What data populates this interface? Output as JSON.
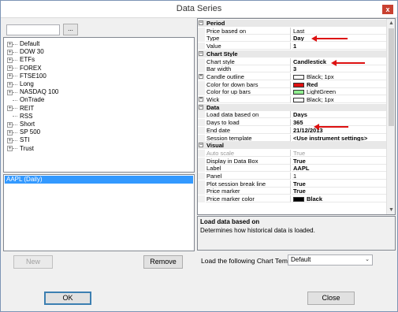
{
  "window": {
    "title": "Data Series",
    "close_glyph": "x"
  },
  "left": {
    "search": {
      "value": "",
      "browse_label": "..."
    },
    "tree": [
      {
        "label": "Default",
        "expand": "+"
      },
      {
        "label": "DOW 30",
        "expand": "+"
      },
      {
        "label": "ETFs",
        "expand": "+"
      },
      {
        "label": "FOREX",
        "expand": "+"
      },
      {
        "label": "FTSE100",
        "expand": "+"
      },
      {
        "label": "Long",
        "expand": "+"
      },
      {
        "label": "NASDAQ 100",
        "expand": "+"
      },
      {
        "label": "OnTrade",
        "expand": ""
      },
      {
        "label": "REIT",
        "expand": "+"
      },
      {
        "label": "RSS",
        "expand": ""
      },
      {
        "label": "Short",
        "expand": "+"
      },
      {
        "label": "SP 500",
        "expand": "+"
      },
      {
        "label": "STI",
        "expand": "+"
      },
      {
        "label": "Trust",
        "expand": "+"
      }
    ],
    "selected_series": "AAPL (Daily)",
    "new_label": "New",
    "remove_label": "Remove"
  },
  "grid": {
    "rows": [
      {
        "kind": "cat",
        "name": "Period",
        "toggle": "⊟"
      },
      {
        "kind": "prop",
        "name": "Price based on",
        "value": "Last"
      },
      {
        "kind": "prop",
        "name": "Type",
        "value": "Day",
        "bold": true
      },
      {
        "kind": "prop",
        "name": "Value",
        "value": "1",
        "bold": true
      },
      {
        "kind": "cat",
        "name": "Chart Style",
        "toggle": "⊟"
      },
      {
        "kind": "prop",
        "name": "Chart style",
        "value": "Candlestick",
        "bold": true
      },
      {
        "kind": "prop",
        "name": "Bar width",
        "value": "3",
        "bold": true
      },
      {
        "kind": "prop",
        "name": "Candle outline",
        "value": "Black; 1px",
        "swatch": "stroke",
        "expand": "+"
      },
      {
        "kind": "prop",
        "name": "Color for down bars",
        "value": "Red",
        "swatch": "#e01010",
        "bold": true
      },
      {
        "kind": "prop",
        "name": "Color for up bars",
        "value": "LightGreen",
        "swatch": "#90ee90"
      },
      {
        "kind": "prop",
        "name": "Wick",
        "value": "Black; 1px",
        "swatch": "stroke",
        "expand": "+"
      },
      {
        "kind": "cat",
        "name": "Data",
        "toggle": "⊟"
      },
      {
        "kind": "prop",
        "name": "Load data based on",
        "value": "Days",
        "bold": true
      },
      {
        "kind": "prop",
        "name": "Days to load",
        "value": "365",
        "bold": true
      },
      {
        "kind": "prop",
        "name": "End date",
        "value": "21/12/2013",
        "bold": true
      },
      {
        "kind": "prop",
        "name": "Session template",
        "value": "<Use instrument settings>",
        "bold": true
      },
      {
        "kind": "cat",
        "name": "Visual",
        "toggle": "⊟"
      },
      {
        "kind": "prop",
        "name": "Auto scale",
        "value": "True",
        "gray": true
      },
      {
        "kind": "prop",
        "name": "Display in Data Box",
        "value": "True",
        "bold": true
      },
      {
        "kind": "prop",
        "name": "Label",
        "value": "AAPL",
        "bold": true
      },
      {
        "kind": "prop",
        "name": "Panel",
        "value": "1"
      },
      {
        "kind": "prop",
        "name": "Plot session break line",
        "value": "True",
        "bold": true
      },
      {
        "kind": "prop",
        "name": "Price marker",
        "value": "True",
        "bold": true
      },
      {
        "kind": "prop",
        "name": "Price marker color",
        "value": "Black",
        "swatch": "#000000",
        "bold": true
      }
    ],
    "scroll_up": "▲",
    "scroll_down": "▼"
  },
  "description": {
    "title": "Load data based on",
    "text": "Determines how historical data is loaded."
  },
  "template": {
    "label": "Load the following Chart Template:",
    "value": "Default",
    "chevron": "⌄"
  },
  "buttons": {
    "ok": "OK",
    "close": "Close"
  },
  "colors": {
    "annotation_arrow": "#dd1111",
    "selection": "#3399ff"
  }
}
